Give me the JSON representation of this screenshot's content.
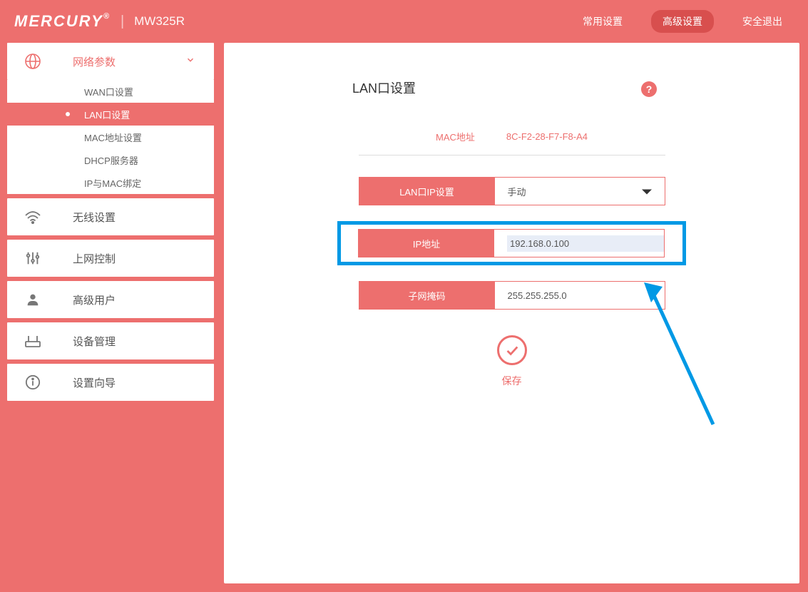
{
  "header": {
    "brand": "MERCURY",
    "model": "MW325R",
    "links": {
      "common": "常用设置",
      "advanced": "高级设置",
      "logout": "安全退出"
    }
  },
  "sidebar": {
    "network": "网络参数",
    "submenu": {
      "wan": "WAN口设置",
      "lan": "LAN口设置",
      "mac": "MAC地址设置",
      "dhcp": "DHCP服务器",
      "ipmac": "IP与MAC绑定"
    },
    "wireless": "无线设置",
    "control": "上网控制",
    "advuser": "高级用户",
    "device": "设备管理",
    "wizard": "设置向导"
  },
  "page": {
    "title": "LAN口设置",
    "mac_label": "MAC地址",
    "mac_value": "8C-F2-28-F7-F8-A4",
    "lan_ip_setting_label": "LAN口IP设置",
    "lan_ip_setting_value": "手动",
    "ip_label": "IP地址",
    "ip_value": "192.168.0.100",
    "subnet_label": "子网掩码",
    "subnet_value": "255.255.255.0",
    "save": "保存"
  }
}
